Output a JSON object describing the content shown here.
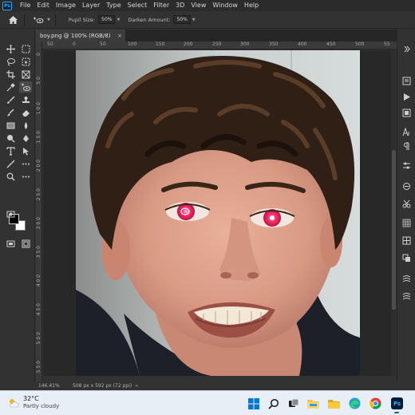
{
  "menubar": {
    "app_icon": "Ps",
    "items": [
      "File",
      "Edit",
      "Image",
      "Layer",
      "Type",
      "Select",
      "Filter",
      "3D",
      "View",
      "Window",
      "Help"
    ]
  },
  "options": {
    "home_icon": "home-icon",
    "tool_icon": "red-eye-tool-icon",
    "pupil_size_label": "Pupil Size:",
    "pupil_size_value": "50%",
    "darken_amount_label": "Darken Amount:",
    "darken_amount_value": "50%"
  },
  "document": {
    "tab_title": "boy.png @ 100% (RGB/8)",
    "close_glyph": "×",
    "ruler_h": [
      "50",
      "0",
      "50",
      "100",
      "150",
      "200",
      "250",
      "300",
      "350",
      "400",
      "450",
      "500",
      "55"
    ],
    "ruler_v": [
      "0",
      "5 0",
      "1 0 0",
      "1 5 0",
      "2 0 0",
      "2 5 0",
      "3 0 0",
      "3 5 0",
      "4 0 0",
      "4 5 0",
      "5 0 0",
      "5 5 0"
    ]
  },
  "status": {
    "zoom": "146.41%",
    "doc_info": "508 px x 592 px (72 ppi)",
    "arrow": ">"
  },
  "colors": {
    "foreground": "#000000",
    "background": "#ffffff",
    "accent": "#31a8ff"
  },
  "taskbar": {
    "weather_temp": "32°C",
    "weather_desc": "Partly cloudy",
    "icons": [
      "windows-start-icon",
      "search-icon",
      "task-view-icon",
      "file-explorer-icon",
      "folder-icon",
      "edge-icon",
      "chrome-icon",
      "photoshop-icon"
    ],
    "photoshop_label": "Ps"
  }
}
